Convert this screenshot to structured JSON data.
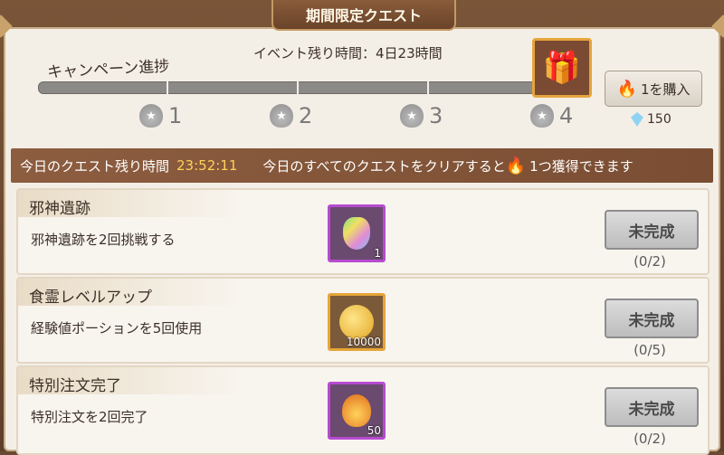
{
  "header": {
    "title": "期間限定クエスト"
  },
  "campaign": {
    "event_time": "イベント残り時間：4日23時間",
    "label": "キャンペーン進捗",
    "progress": 0.0,
    "milestones": [
      "1",
      "2",
      "3",
      "4"
    ]
  },
  "shop": {
    "buy_label": "1を購入",
    "gem_count": "150"
  },
  "banner": {
    "today_label": "今日のクエスト残り時間",
    "timer": "23:52:11",
    "reward_text_before": "今日のすべてのクエストをクリアすると",
    "reward_text_after": "1つ獲得できます"
  },
  "quests": [
    {
      "title": "邪神遺跡",
      "desc": "邪神遺跡を2回挑戦する",
      "reward_qty": "1",
      "reward_icon": "rainbow-hand-icon",
      "status": "未完成",
      "progress": "(0/2)"
    },
    {
      "title": "食霊レベルアップ",
      "desc": "経験値ポーションを5回使用",
      "reward_qty": "10000",
      "reward_icon": "gold-coin-icon",
      "status": "未完成",
      "progress": "(0/5)"
    },
    {
      "title": "特別注文完了",
      "desc": "特別注文を2回完了",
      "reward_qty": "50",
      "reward_icon": "golden-onion-icon",
      "status": "未完成",
      "progress": "(0/2)"
    }
  ],
  "colors": {
    "accent": "#e8a640",
    "banner": "#8d5d40",
    "timer": "#ffd15a"
  }
}
